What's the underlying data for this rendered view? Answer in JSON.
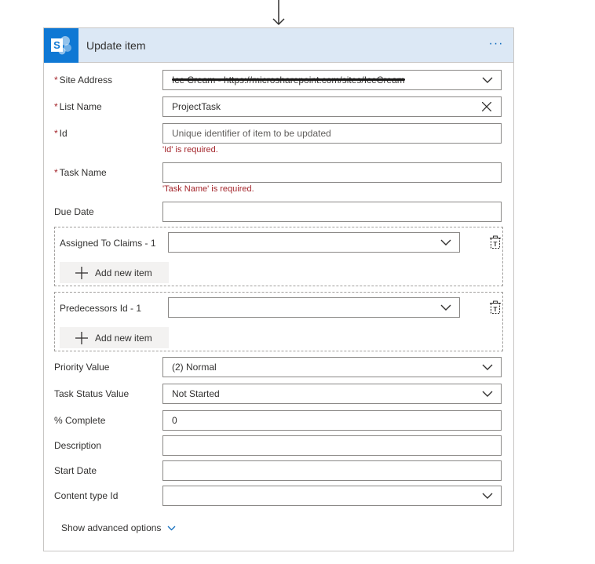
{
  "card": {
    "title": "Update item",
    "more_label": "···"
  },
  "fields": {
    "site_address": {
      "label": "Site Address",
      "required": "*",
      "value": "Ice Cream - https://microsharepoint.com/sites/IceCream"
    },
    "list_name": {
      "label": "List Name",
      "required": "*",
      "value": "ProjectTask"
    },
    "id": {
      "label": "Id",
      "required": "*",
      "placeholder": "Unique identifier of item to be updated",
      "error": "'Id' is required."
    },
    "task_name": {
      "label": "Task Name",
      "required": "*",
      "value": "",
      "error": "'Task Name' is required."
    },
    "due_date": {
      "label": "Due Date",
      "value": ""
    },
    "assigned_to": {
      "label": "Assigned To Claims - 1",
      "value": "",
      "add_label": "Add new item"
    },
    "predecessors": {
      "label": "Predecessors Id - 1",
      "value": "",
      "add_label": "Add new item"
    },
    "priority": {
      "label": "Priority Value",
      "value": "(2) Normal"
    },
    "task_status": {
      "label": "Task Status Value",
      "value": "Not Started"
    },
    "percent_complete": {
      "label": "% Complete",
      "value": "0"
    },
    "description": {
      "label": "Description",
      "value": ""
    },
    "start_date": {
      "label": "Start Date",
      "value": ""
    },
    "content_type": {
      "label": "Content type Id",
      "value": ""
    }
  },
  "advanced": {
    "label": "Show advanced options"
  },
  "icons": {
    "connector": "down-arrow-icon",
    "logo": "sharepoint-logo-icon",
    "dropdown": "chevron-down-icon",
    "clear": "close-icon",
    "delete": "delete-item-icon",
    "add": "plus-icon",
    "advanced": "chevron-down-icon"
  },
  "colors": {
    "header_bg": "#dce8f5",
    "logo_bg": "#0f78d4",
    "error": "#a4262c",
    "accent": "#0f6cbd"
  }
}
